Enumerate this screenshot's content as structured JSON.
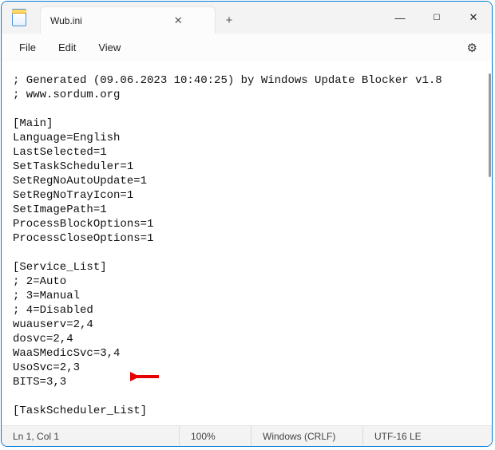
{
  "titlebar": {
    "tab_title": "Wub.ini",
    "close_glyph": "✕",
    "new_tab_glyph": "+",
    "min_glyph": "—",
    "max_glyph": "☐",
    "window_close_glyph": "✕"
  },
  "menubar": {
    "file": "File",
    "edit": "Edit",
    "view": "View",
    "gear_glyph": "⚙"
  },
  "editor": {
    "lines": [
      "; Generated (09.06.2023 10:40:25) by Windows Update Blocker v1.8",
      "; www.sordum.org",
      "",
      "[Main]",
      "Language=English",
      "LastSelected=1",
      "SetTaskScheduler=1",
      "SetRegNoAutoUpdate=1",
      "SetRegNoTrayIcon=1",
      "SetImagePath=1",
      "ProcessBlockOptions=1",
      "ProcessCloseOptions=1",
      "",
      "[Service_List]",
      "; 2=Auto",
      "; 3=Manual",
      "; 4=Disabled",
      "wuauserv=2,4",
      "dosvc=2,4",
      "WaaSMedicSvc=3,4",
      "UsoSvc=2,3",
      "BITS=3,3",
      "",
      "[TaskScheduler_List]"
    ]
  },
  "statusbar": {
    "position": "Ln 1, Col 1",
    "zoom": "100%",
    "line_ending": "Windows (CRLF)",
    "encoding": "UTF-16 LE"
  }
}
